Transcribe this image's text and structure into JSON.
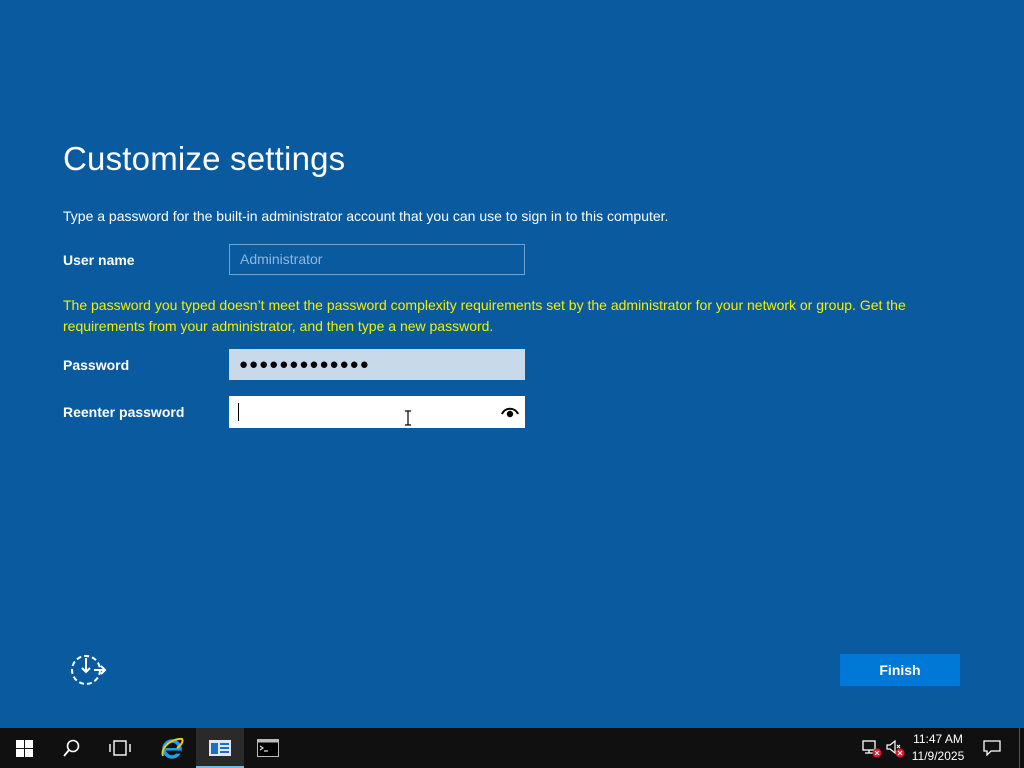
{
  "setup": {
    "title": "Customize settings",
    "intro": "Type a password for the built-in administrator account that you can use to sign in to this computer.",
    "username_label": "User name",
    "username_value": "Administrator",
    "warning": "The password you typed doesn’t meet the password complexity requirements set by the administrator for your network or group. Get the requirements from your administrator, and then type a new password.",
    "password_label": "Password",
    "password_mask": "●●●●●●●●●●●●●",
    "reenter_label": "Reenter password",
    "reenter_value": "",
    "finish_label": "Finish",
    "icons": {
      "ease_of_access": "ease-of-access-icon",
      "reveal": "reveal-password-eye-icon"
    }
  },
  "taskbar": {
    "apps": [
      {
        "name": "start",
        "icon": "windows-logo-icon"
      },
      {
        "name": "search",
        "icon": "search-icon"
      },
      {
        "name": "task-view",
        "icon": "task-view-icon"
      },
      {
        "name": "internet-explorer",
        "icon": "internet-explorer-icon"
      },
      {
        "name": "server-manager",
        "icon": "server-manager-icon",
        "active": true
      },
      {
        "name": "command-prompt",
        "icon": "command-prompt-icon"
      }
    ],
    "tray": {
      "network": "network-disconnected-icon",
      "volume": "volume-muted-icon"
    },
    "time": "11:47 AM",
    "date": "11/9/2025"
  },
  "colors": {
    "background": "#0a5aa0",
    "warning": "#f0f000",
    "button": "#0078d7",
    "taskbar": "#101010"
  }
}
